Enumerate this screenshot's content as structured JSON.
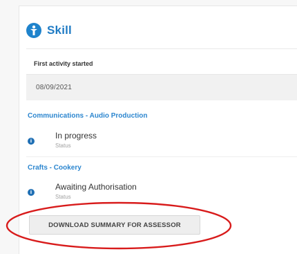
{
  "header": {
    "title": "Skill",
    "icon": "skill-icon"
  },
  "activity": {
    "label": "First activity started",
    "value": "08/09/2021"
  },
  "skills": [
    {
      "heading": "Communications - Audio Production",
      "status_text": "In progress",
      "status_label": "Status",
      "icon": "info-icon"
    },
    {
      "heading": "Crafts - Cookery",
      "status_text": "Awaiting Authorisation",
      "status_label": "Status",
      "icon": "info-icon"
    }
  ],
  "actions": {
    "download_label": "DOWNLOAD SUMMARY FOR ASSESSOR"
  },
  "colors": {
    "accent": "#1f7bc4",
    "annotation": "#d81b1b"
  }
}
